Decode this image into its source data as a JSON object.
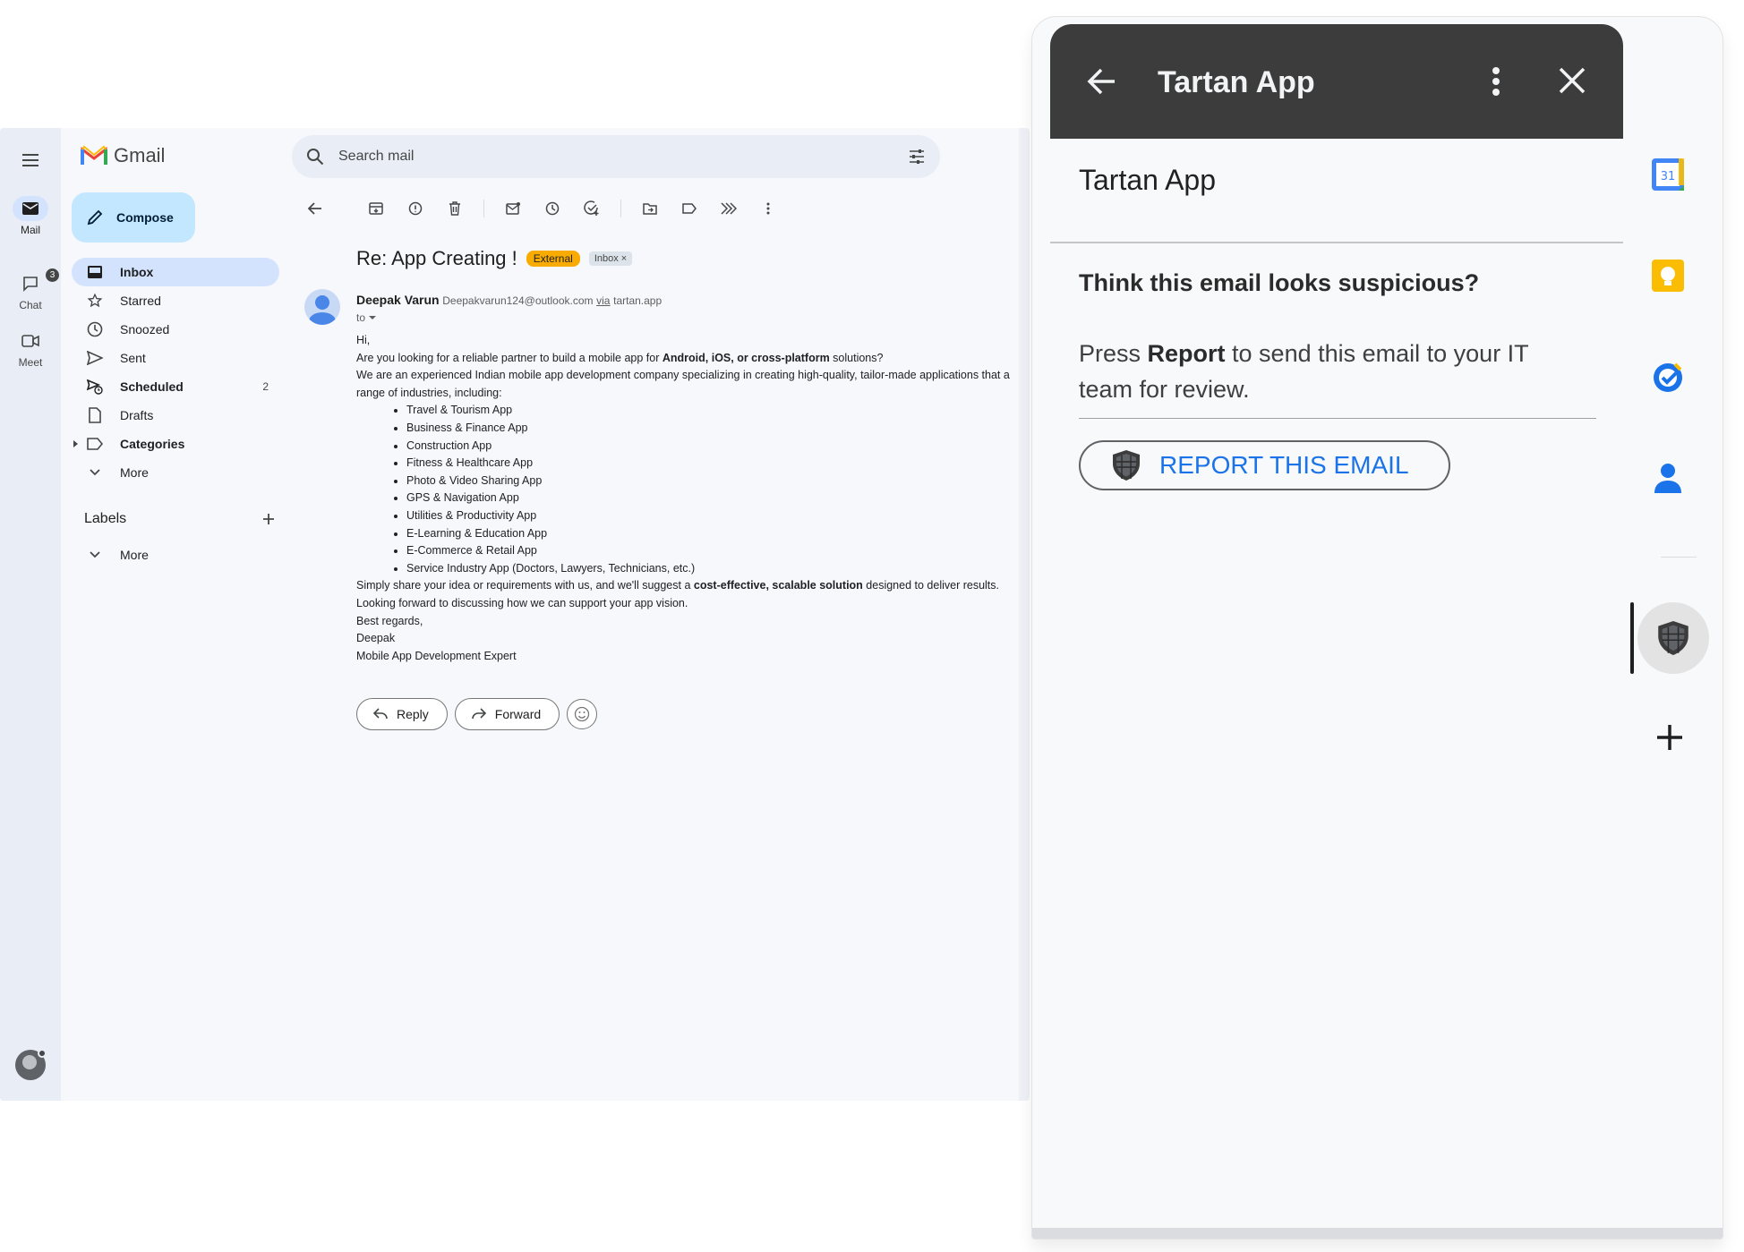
{
  "gmail": {
    "brand": "Gmail",
    "compose_label": "Compose",
    "rail": [
      {
        "label": "Mail",
        "icon": "mail-icon"
      },
      {
        "label": "Chat",
        "icon": "chat-icon",
        "badge": "3"
      },
      {
        "label": "Meet",
        "icon": "meet-icon"
      }
    ],
    "nav": [
      {
        "label": "Inbox",
        "icon": "inbox-icon",
        "count": ""
      },
      {
        "label": "Starred",
        "icon": "star-icon",
        "count": ""
      },
      {
        "label": "Snoozed",
        "icon": "clock-icon",
        "count": ""
      },
      {
        "label": "Sent",
        "icon": "send-icon",
        "count": ""
      },
      {
        "label": "Scheduled",
        "icon": "scheduled-icon",
        "count": "2"
      },
      {
        "label": "Drafts",
        "icon": "draft-icon",
        "count": ""
      },
      {
        "label": "Categories",
        "icon": "label-icon",
        "count": ""
      },
      {
        "label": "More",
        "icon": "chevron-down-icon",
        "count": ""
      }
    ],
    "labels_heading": "Labels",
    "labels_more": "More",
    "search_placeholder": "Search mail"
  },
  "email": {
    "subject": "Re: App Creating !",
    "tag_external": "External",
    "tag_inbox": "Inbox",
    "sender_name": "Deepak Varun",
    "sender_email": "Deepakvarun124@outlook.com",
    "via_label": "via",
    "via_domain": "tartan.app",
    "to_label": "to",
    "greeting": "Hi,",
    "line1_pre": "Are you looking for a reliable partner to build a mobile app for ",
    "line1_bold": "Android, iOS, or cross-platform",
    "line1_post": " solutions?",
    "line2": "We are an experienced Indian mobile app development company specializing in creating high-quality, tailor-made applications that a",
    "line3": "range of industries, including:",
    "industries": [
      "Travel & Tourism App",
      "Business & Finance App",
      "Construction App",
      "Fitness & Healthcare App",
      "Photo & Video Sharing App",
      "GPS & Navigation App",
      "Utilities & Productivity App",
      "E-Learning & Education App",
      "E-Commerce & Retail App",
      "Service Industry App (Doctors, Lawyers, Technicians, etc.)"
    ],
    "line4_pre": "Simply share your idea or requirements with us, and we'll suggest a ",
    "line4_bold": "cost-effective, scalable solution",
    "line4_post": " designed to deliver results.",
    "line5": "Looking forward to discussing how we can support your app vision.",
    "closing": "Best regards,",
    "sign_name": "Deepak",
    "sign_title": "Mobile App Development Expert",
    "reply_label": "Reply",
    "forward_label": "Forward"
  },
  "panel": {
    "header_title": "Tartan App",
    "card_title": "Tartan App",
    "question": "Think this email looks suspicious?",
    "msg_pre": "Press ",
    "msg_bold": "Report",
    "msg_post": " to send this email to your IT team for review.",
    "report_button": "REPORT THIS EMAIL"
  },
  "colors": {
    "accent_blue": "#1a73e8",
    "nav_active": "#d3e3fd",
    "compose": "#c2e7ff",
    "external_tag": "#f9ab00",
    "panel_header": "#3c3c3c"
  }
}
